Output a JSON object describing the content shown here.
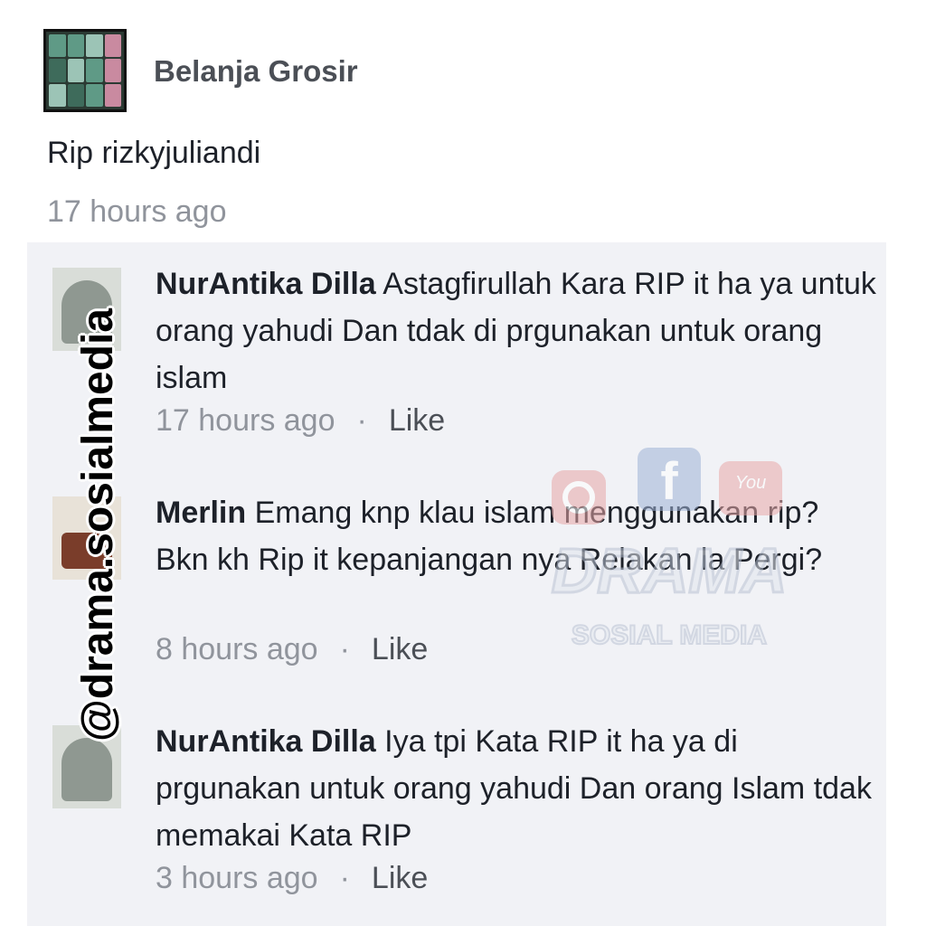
{
  "post": {
    "page_name": "Belanja Grosir",
    "text": "Rip rizkyjuliandi",
    "time": "17 hours ago"
  },
  "comments": [
    {
      "author": "NurAntika Dilla",
      "text_line1": " Astagfirullah Kara RIP it ha",
      "text_rest": "ya untuk orang yahudi Dan tdak di prgunakan untuk orang islam",
      "time": "17 hours ago",
      "like_label": "Like"
    },
    {
      "author": "Merlin",
      "text_line1": " Emang knp klau islam menggunakan",
      "text_rest": "rip? Bkn kh Rip it kepanjangan nya Relakan la Pergi?",
      "time": "8 hours ago",
      "like_label": "Like"
    },
    {
      "author": "NurAntika Dilla",
      "text_line1": " Iya tpi Kata RIP it ha ya di",
      "text_rest": "prgunakan untuk orang yahudi Dan orang Islam tdak memakai Kata RIP",
      "time": "3 hours ago",
      "like_label": "Like"
    }
  ],
  "meta_separator": "·",
  "watermark": {
    "handle": "@drama.sosialmedia",
    "logo_title": "DRAMA",
    "logo_subtitle": "SOSIAL MEDIA",
    "logo_icons": [
      "instagram-icon",
      "facebook-icon",
      "youtube-icon"
    ]
  }
}
